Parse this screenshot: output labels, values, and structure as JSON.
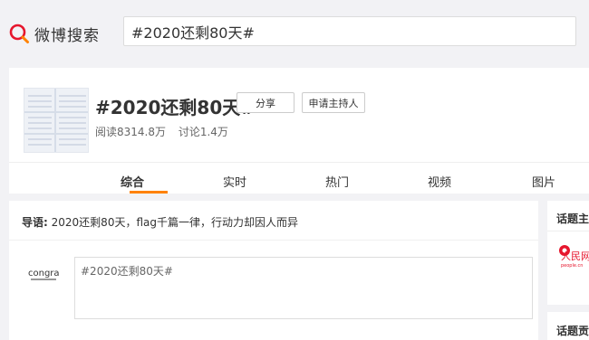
{
  "header": {
    "logo_text": "微博搜索",
    "search_value": "#2020还剩80天#"
  },
  "topic": {
    "title": "#2020还剩80天#",
    "reads": "阅读8314.8万",
    "discussions": "讨论1.4万",
    "share_label": "分享",
    "apply_host_label": "申请主持人"
  },
  "tabs": [
    {
      "label": "综合",
      "active": true
    },
    {
      "label": "实时",
      "active": false
    },
    {
      "label": "热门",
      "active": false
    },
    {
      "label": "视频",
      "active": false
    },
    {
      "label": "图片",
      "active": false
    }
  ],
  "lead": {
    "label": "导语:",
    "text": "2020还剩80天，flag千篇一律，行动力却因人而异"
  },
  "composer": {
    "value": "#2020还剩80天#",
    "brand_logo": "congra"
  },
  "side": {
    "panel1_title": "话题主持",
    "panel2_title": "话题贡献",
    "paper_logo": "人民网",
    "paper_domain": "people.cn"
  },
  "colors": {
    "accent": "#ff8200",
    "logo_red": "#e6162d"
  }
}
